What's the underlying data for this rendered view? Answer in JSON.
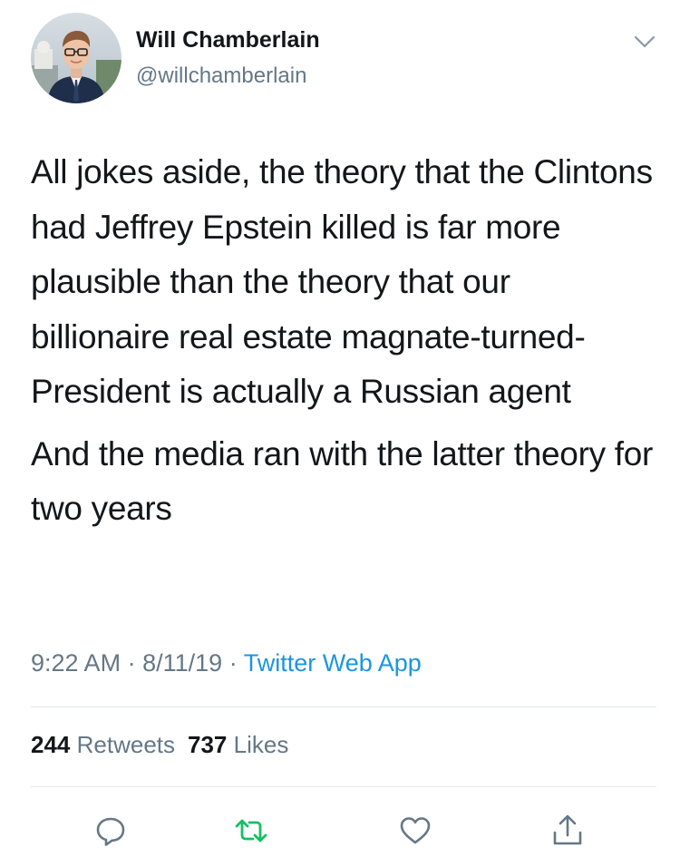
{
  "author": {
    "name": "Will Chamberlain",
    "handle": "@willchamberlain",
    "avatar_icon": "profile-photo"
  },
  "tweet": {
    "paragraphs": [
      "All jokes aside, the theory that the Clintons had Jeffrey Epstein killed is far more plausible than the theory that our billionaire real estate magnate-turned-President is actually a Russian agent",
      "And the media ran with the latter theory for two years"
    ],
    "time": "9:22 AM",
    "date": "8/11/19",
    "separator": "·",
    "source": "Twitter Web App"
  },
  "stats": {
    "retweets_count": "244",
    "retweets_label": "Retweets",
    "likes_count": "737",
    "likes_label": "Likes"
  },
  "actions": {
    "reply_icon": "reply-icon",
    "retweet_icon": "retweet-icon",
    "like_icon": "heart-icon",
    "share_icon": "share-icon"
  },
  "colors": {
    "text": "#14171a",
    "secondary_text": "#657786",
    "link": "#1b95e0",
    "retweet_green": "#17bf63",
    "icon_gray": "#657786",
    "divider": "#e1e8ed"
  }
}
